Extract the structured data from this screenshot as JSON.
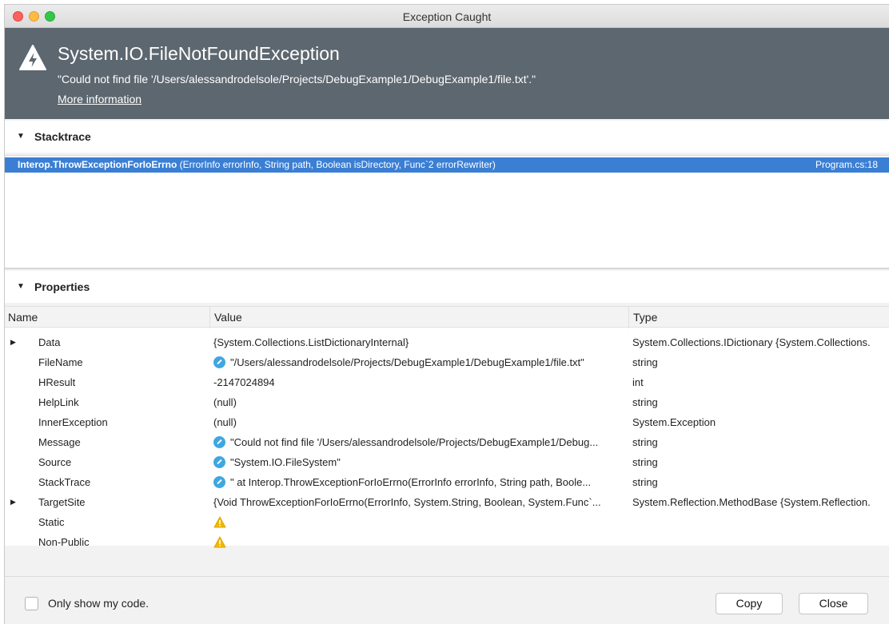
{
  "window": {
    "title": "Exception Caught"
  },
  "exception": {
    "icon": "lightning-warning-icon",
    "type": "System.IO.FileNotFoundException",
    "message": "\"Could not find file '/Users/alessandrodelsole/Projects/DebugExample1/DebugExample1/file.txt'.\"",
    "more_info": "More information"
  },
  "stacktrace": {
    "label": "Stacktrace",
    "frames": [
      {
        "method": "Interop.ThrowExceptionForIoErrno",
        "args": " (ErrorInfo errorInfo, String path, Boolean isDirectory, Func`2 errorRewriter)",
        "file": "Program.cs:18",
        "selected": true
      }
    ]
  },
  "properties": {
    "label": "Properties",
    "columns": [
      "Name",
      "Value",
      "Type"
    ],
    "rows": [
      {
        "expandable": true,
        "name": "Data",
        "value": "{System.Collections.ListDictionaryInternal}",
        "icon": "",
        "type": "System.Collections.IDictionary {System.Collections."
      },
      {
        "expandable": false,
        "name": "FileName",
        "value": "\"/Users/alessandrodelsole/Projects/DebugExample1/DebugExample1/file.txt\"",
        "icon": "visualizer-icon",
        "type": "string"
      },
      {
        "expandable": false,
        "name": "HResult",
        "value": "-2147024894",
        "icon": "",
        "type": "int"
      },
      {
        "expandable": false,
        "name": "HelpLink",
        "value": "(null)",
        "icon": "",
        "type": "string"
      },
      {
        "expandable": false,
        "name": "InnerException",
        "value": "(null)",
        "icon": "",
        "type": "System.Exception"
      },
      {
        "expandable": false,
        "name": "Message",
        "value": "\"Could not find file '/Users/alessandrodelsole/Projects/DebugExample1/Debug...",
        "icon": "visualizer-icon",
        "type": "string"
      },
      {
        "expandable": false,
        "name": "Source",
        "value": "\"System.IO.FileSystem\"",
        "icon": "visualizer-icon",
        "type": "string"
      },
      {
        "expandable": false,
        "name": "StackTrace",
        "value": "\"   at Interop.ThrowExceptionForIoErrno(ErrorInfo errorInfo, String path, Boole...",
        "icon": "visualizer-icon",
        "type": "string"
      },
      {
        "expandable": true,
        "name": "TargetSite",
        "value": "{Void ThrowExceptionForIoErrno(ErrorInfo, System.String, Boolean, System.Func`...",
        "icon": "",
        "type": "System.Reflection.MethodBase {System.Reflection."
      },
      {
        "expandable": false,
        "name": "Static",
        "value": "",
        "icon": "warning-icon",
        "type": ""
      },
      {
        "expandable": false,
        "name": "Non-Public",
        "value": "",
        "icon": "warning-icon",
        "type": ""
      }
    ]
  },
  "footer": {
    "checkbox_label": "Only show my code.",
    "checkbox_checked": false,
    "copy_label": "Copy",
    "close_label": "Close"
  },
  "colors": {
    "header_bg": "#5d6770",
    "selection": "#3b7fd4",
    "visualizer": "#3fa7e0",
    "warning": "#f2b705"
  }
}
